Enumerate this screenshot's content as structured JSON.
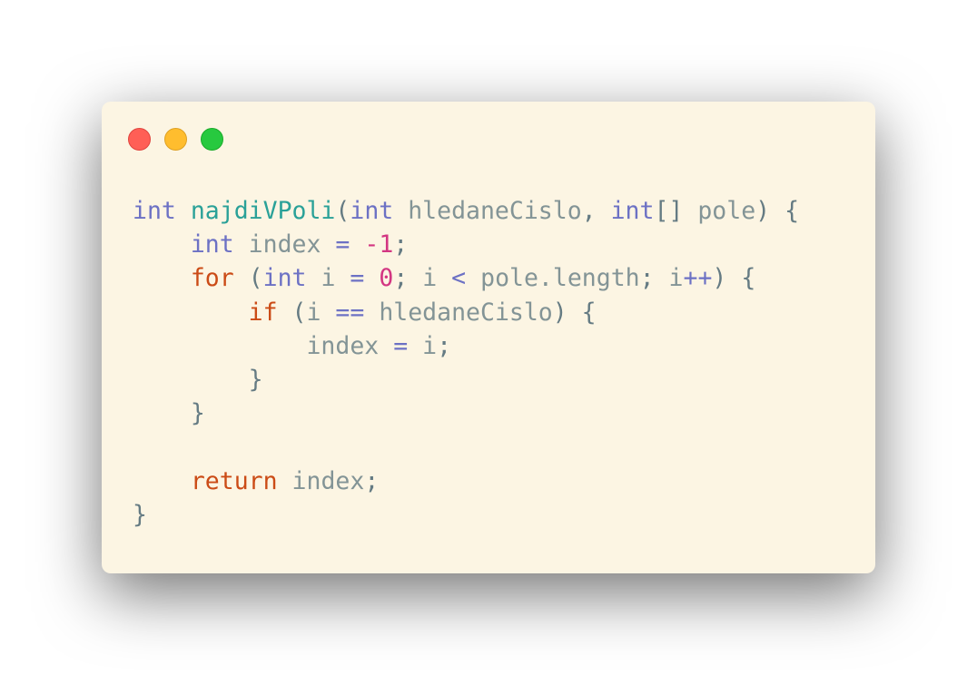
{
  "window": {
    "controls": [
      "close",
      "minimize",
      "maximize"
    ]
  },
  "colors": {
    "background": "#fcf5e3",
    "type": "#6c71c4",
    "function": "#2aa198",
    "keyword": "#cb4b16",
    "number": "#d33682",
    "identifier": "#839496",
    "punctuation": "#657b83"
  },
  "code": {
    "lines": [
      [
        {
          "t": "int",
          "k": "type"
        },
        {
          "t": " ",
          "k": "punc"
        },
        {
          "t": "najdiVPoli",
          "k": "fn"
        },
        {
          "t": "(",
          "k": "punc"
        },
        {
          "t": "int",
          "k": "type"
        },
        {
          "t": " ",
          "k": "punc"
        },
        {
          "t": "hledaneCislo",
          "k": "id"
        },
        {
          "t": ", ",
          "k": "punc"
        },
        {
          "t": "int",
          "k": "type"
        },
        {
          "t": "[] ",
          "k": "punc"
        },
        {
          "t": "pole",
          "k": "id"
        },
        {
          "t": ") {",
          "k": "punc"
        }
      ],
      [
        {
          "t": "    ",
          "k": "punc"
        },
        {
          "t": "int",
          "k": "type"
        },
        {
          "t": " ",
          "k": "punc"
        },
        {
          "t": "index",
          "k": "id"
        },
        {
          "t": " ",
          "k": "punc"
        },
        {
          "t": "=",
          "k": "op"
        },
        {
          "t": " ",
          "k": "punc"
        },
        {
          "t": "-1",
          "k": "num"
        },
        {
          "t": ";",
          "k": "punc"
        }
      ],
      [
        {
          "t": "    ",
          "k": "punc"
        },
        {
          "t": "for",
          "k": "kw"
        },
        {
          "t": " (",
          "k": "punc"
        },
        {
          "t": "int",
          "k": "type"
        },
        {
          "t": " ",
          "k": "punc"
        },
        {
          "t": "i",
          "k": "id"
        },
        {
          "t": " ",
          "k": "punc"
        },
        {
          "t": "=",
          "k": "op"
        },
        {
          "t": " ",
          "k": "punc"
        },
        {
          "t": "0",
          "k": "num"
        },
        {
          "t": "; ",
          "k": "punc"
        },
        {
          "t": "i",
          "k": "id"
        },
        {
          "t": " ",
          "k": "punc"
        },
        {
          "t": "<",
          "k": "op"
        },
        {
          "t": " ",
          "k": "punc"
        },
        {
          "t": "pole.length",
          "k": "id"
        },
        {
          "t": "; ",
          "k": "punc"
        },
        {
          "t": "i",
          "k": "id"
        },
        {
          "t": "++",
          "k": "op"
        },
        {
          "t": ") {",
          "k": "punc"
        }
      ],
      [
        {
          "t": "        ",
          "k": "punc"
        },
        {
          "t": "if",
          "k": "kw"
        },
        {
          "t": " (",
          "k": "punc"
        },
        {
          "t": "i",
          "k": "id"
        },
        {
          "t": " ",
          "k": "punc"
        },
        {
          "t": "==",
          "k": "op"
        },
        {
          "t": " ",
          "k": "punc"
        },
        {
          "t": "hledaneCislo",
          "k": "id"
        },
        {
          "t": ") {",
          "k": "punc"
        }
      ],
      [
        {
          "t": "            ",
          "k": "punc"
        },
        {
          "t": "index",
          "k": "id"
        },
        {
          "t": " ",
          "k": "punc"
        },
        {
          "t": "=",
          "k": "op"
        },
        {
          "t": " ",
          "k": "punc"
        },
        {
          "t": "i",
          "k": "id"
        },
        {
          "t": ";",
          "k": "punc"
        }
      ],
      [
        {
          "t": "        }",
          "k": "punc"
        }
      ],
      [
        {
          "t": "    }",
          "k": "punc"
        }
      ],
      [
        {
          "t": "",
          "k": "punc"
        }
      ],
      [
        {
          "t": "    ",
          "k": "punc"
        },
        {
          "t": "return",
          "k": "kw"
        },
        {
          "t": " ",
          "k": "punc"
        },
        {
          "t": "index",
          "k": "id"
        },
        {
          "t": ";",
          "k": "punc"
        }
      ],
      [
        {
          "t": "}",
          "k": "punc"
        }
      ]
    ]
  }
}
